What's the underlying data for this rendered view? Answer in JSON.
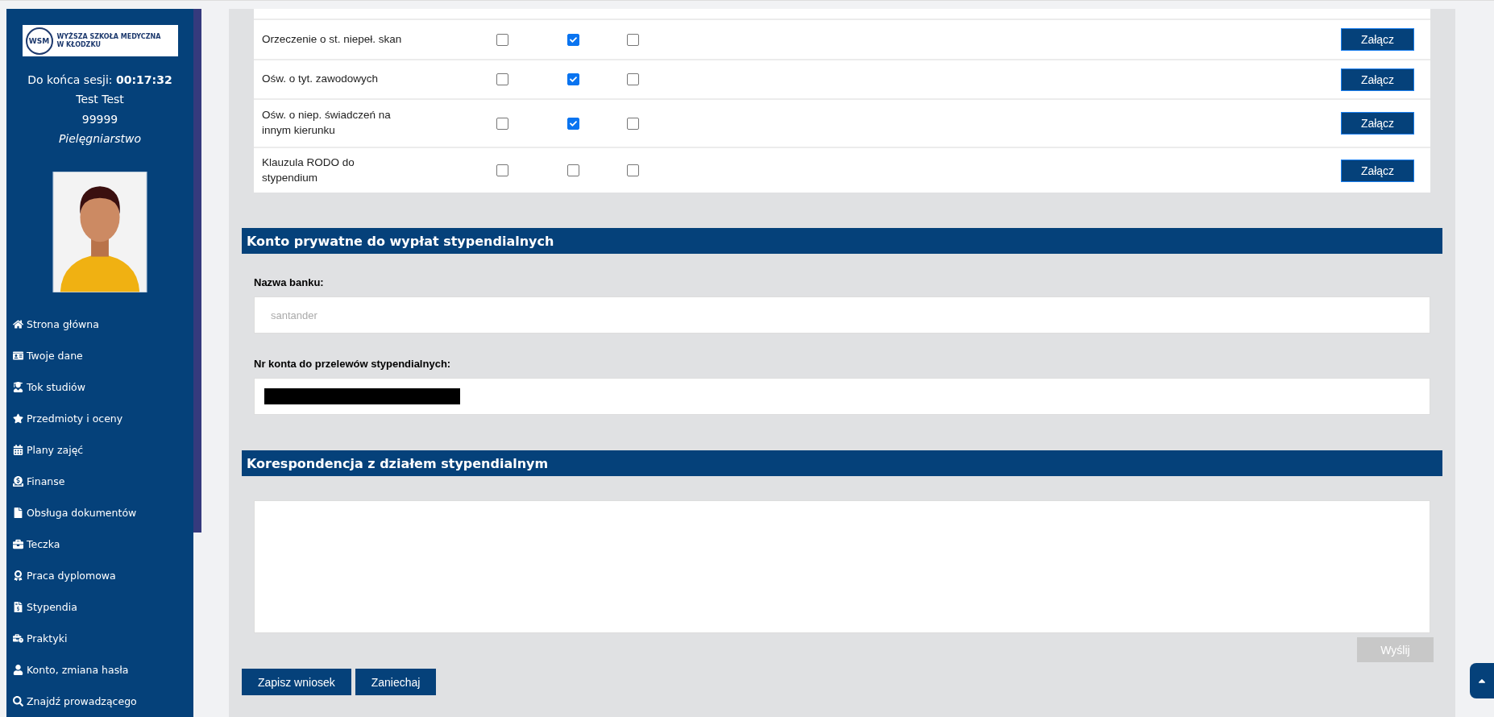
{
  "sidebar": {
    "logo": {
      "monogram": "WSM",
      "line_1": "WYŻSZA SZKOŁA MEDYCZNA",
      "line_2": "W KŁODZKU"
    },
    "session": {
      "label": "Do końca sesji:",
      "time": "00:17:32"
    },
    "user": {
      "name": "Test Test",
      "id": "99999",
      "program": "Pielęgniarstwo"
    },
    "menu": [
      {
        "label": "Strona główna"
      },
      {
        "label": "Twoje dane"
      },
      {
        "label": "Tok studiów"
      },
      {
        "label": "Przedmioty i oceny"
      },
      {
        "label": "Plany zajęć"
      },
      {
        "label": "Finanse"
      },
      {
        "label": "Obsługa dokumentów"
      },
      {
        "label": "Teczka"
      },
      {
        "label": "Praca dyplomowa"
      },
      {
        "label": "Stypendia"
      },
      {
        "label": "Praktyki"
      },
      {
        "label": "Konto, zmiana hasła"
      },
      {
        "label": "Znajdź prowadzącego"
      }
    ]
  },
  "documents": {
    "rows": [
      {
        "label": "Orzeczenie o st. niepeł. skan",
        "checks": [
          false,
          true,
          false
        ],
        "button": "Załącz"
      },
      {
        "label": "Ośw. o tyt. zawodowych",
        "checks": [
          false,
          true,
          false
        ],
        "button": "Załącz"
      },
      {
        "label": "Ośw. o niep. świadczeń na innym kierunku",
        "checks": [
          false,
          true,
          false
        ],
        "button": "Załącz"
      },
      {
        "label": "Klauzula RODO do stypendium",
        "checks": [
          false,
          false,
          false
        ],
        "button": "Załącz"
      }
    ]
  },
  "bank_account": {
    "title": "Konto prywatne do wypłat stypendialnych",
    "fields": [
      {
        "label": "Nazwa banku:",
        "placeholder": "santander",
        "redacted": false
      },
      {
        "label": "Nr konta do przelewów stypendialnych:",
        "redacted": true
      }
    ]
  },
  "correspondence": {
    "title": "Korespondencja z działem stypendialnym",
    "send_button": {
      "label": "Wyślij",
      "disabled": true
    }
  },
  "actions": [
    "Zapisz wniosek",
    "Zaniechaj"
  ]
}
